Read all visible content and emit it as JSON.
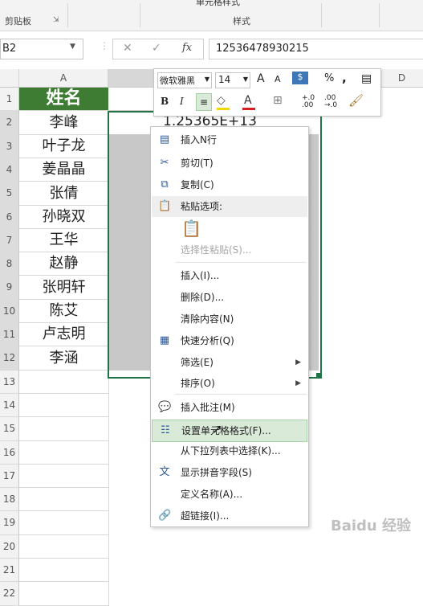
{
  "ribbon": {
    "group_clipboard": "剪贴板",
    "group_styles": "样式",
    "cell_styles_btn": "单元格样式"
  },
  "formula_bar": {
    "name_box": "B2",
    "cancel_icon": "✕",
    "confirm_icon": "✓",
    "fx_label": "fx",
    "value": "12536478930215"
  },
  "columns": [
    "A",
    "D"
  ],
  "rows": [
    "1",
    "2",
    "3",
    "4",
    "5",
    "6",
    "7",
    "8",
    "9",
    "10",
    "11",
    "12",
    "13",
    "14",
    "15",
    "16",
    "17",
    "18",
    "19",
    "20",
    "21",
    "22"
  ],
  "sheet": {
    "header_cell": "姓名",
    "names": [
      "李峰",
      "叶子龙",
      "姜晶晶",
      "张倩",
      "孙晓双",
      "王华",
      "赵静",
      "张明轩",
      "陈艾",
      "卢志明",
      "李涵"
    ],
    "b2_value": "1.25365E+13",
    "header_color": "#3d7c32"
  },
  "mini_toolbar": {
    "font_name": "微软雅黑",
    "font_size": "14",
    "grow": "A",
    "shrink": "A",
    "percent": "%",
    "comma": ",",
    "bold": "B",
    "italic": "I",
    "font_color_letter": "A",
    "inc_decimal": "+.0 .00",
    "dec_decimal": ".00 →.0"
  },
  "context_menu": {
    "items": [
      {
        "label": "插入N行",
        "icon": "insert-rows-icon",
        "glyph": "▤"
      },
      {
        "label": "剪切(T)",
        "icon": "scissors-icon",
        "glyph": "✂"
      },
      {
        "label": "复制(C)",
        "icon": "copy-icon",
        "glyph": "⧉"
      },
      {
        "label": "粘贴选项:",
        "icon": "paste-icon",
        "glyph": "📋"
      },
      {
        "label": "选择性粘贴(S)...",
        "disabled": true
      },
      {
        "label": "插入(I)..."
      },
      {
        "label": "删除(D)..."
      },
      {
        "label": "清除内容(N)"
      },
      {
        "label": "快速分析(Q)",
        "icon": "quick-analysis-icon",
        "glyph": "▦"
      },
      {
        "label": "筛选(E)",
        "submenu": true
      },
      {
        "label": "排序(O)",
        "submenu": true
      },
      {
        "label": "插入批注(M)",
        "icon": "comment-icon",
        "glyph": "💬"
      },
      {
        "label": "设置单元格格式(F)...",
        "icon": "format-cells-icon",
        "glyph": "☷"
      },
      {
        "label": "从下拉列表中选择(K)..."
      },
      {
        "label": "显示拼音字段(S)",
        "icon": "phonetic-icon",
        "glyph": "文"
      },
      {
        "label": "定义名称(A)..."
      },
      {
        "label": "超链接(I)...",
        "icon": "hyperlink-icon",
        "glyph": "🔗"
      }
    ]
  },
  "watermark": "Baidu 经验"
}
